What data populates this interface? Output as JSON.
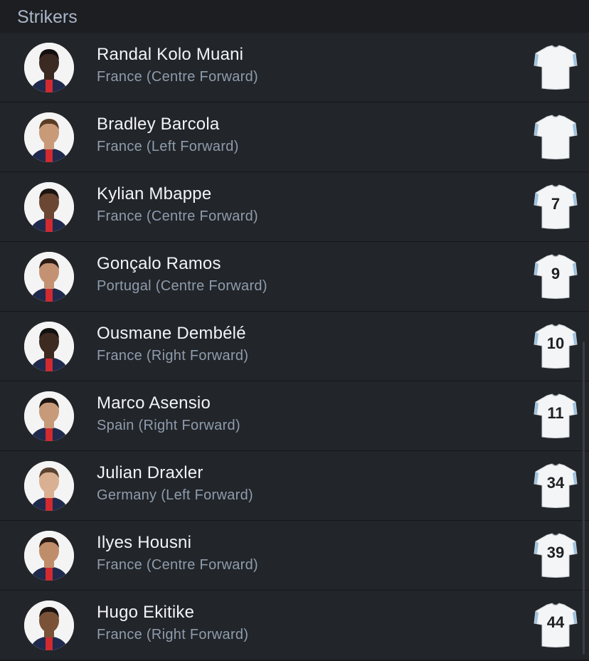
{
  "section": {
    "title": "Strikers"
  },
  "players": [
    {
      "name": "Randal Kolo Muani",
      "detail": "France (Centre Forward)",
      "number": "",
      "skin": "#3b2a22",
      "hair": "#141010"
    },
    {
      "name": "Bradley Barcola",
      "detail": "France (Left Forward)",
      "number": "",
      "skin": "#c89a78",
      "hair": "#5a3c25"
    },
    {
      "name": "Kylian Mbappe",
      "detail": "France (Centre Forward)",
      "number": "7",
      "skin": "#6b4632",
      "hair": "#1c1410"
    },
    {
      "name": "Gonçalo Ramos",
      "detail": "Portugal (Centre Forward)",
      "number": "9",
      "skin": "#c49273",
      "hair": "#2b1d15"
    },
    {
      "name": "Ousmane Dembélé",
      "detail": "France (Right Forward)",
      "number": "10",
      "skin": "#3d2a20",
      "hair": "#131010"
    },
    {
      "name": "Marco Asensio",
      "detail": "Spain (Right Forward)",
      "number": "11",
      "skin": "#c79a7a",
      "hair": "#1e1612"
    },
    {
      "name": "Julian Draxler",
      "detail": "Germany (Left Forward)",
      "number": "34",
      "skin": "#d9b091",
      "hair": "#5b4330"
    },
    {
      "name": "Ilyes Housni",
      "detail": "France (Centre Forward)",
      "number": "39",
      "skin": "#c08d6a",
      "hair": "#2a1c14"
    },
    {
      "name": "Hugo Ekitike",
      "detail": "France (Right Forward)",
      "number": "44",
      "skin": "#7a5238",
      "hair": "#1a1411"
    }
  ],
  "colors": {
    "background": "#222529",
    "header_text": "#a9b6c6",
    "name_text": "#f2f4f7",
    "detail_text": "#8f9cad",
    "kit_navy": "#1f2a4d",
    "kit_red": "#d12a2f",
    "jersey_white": "#f4f5f6",
    "jersey_trim": "#9fc3e0"
  },
  "icons": {
    "avatar": "player-photo",
    "kit": "jersey-icon"
  }
}
